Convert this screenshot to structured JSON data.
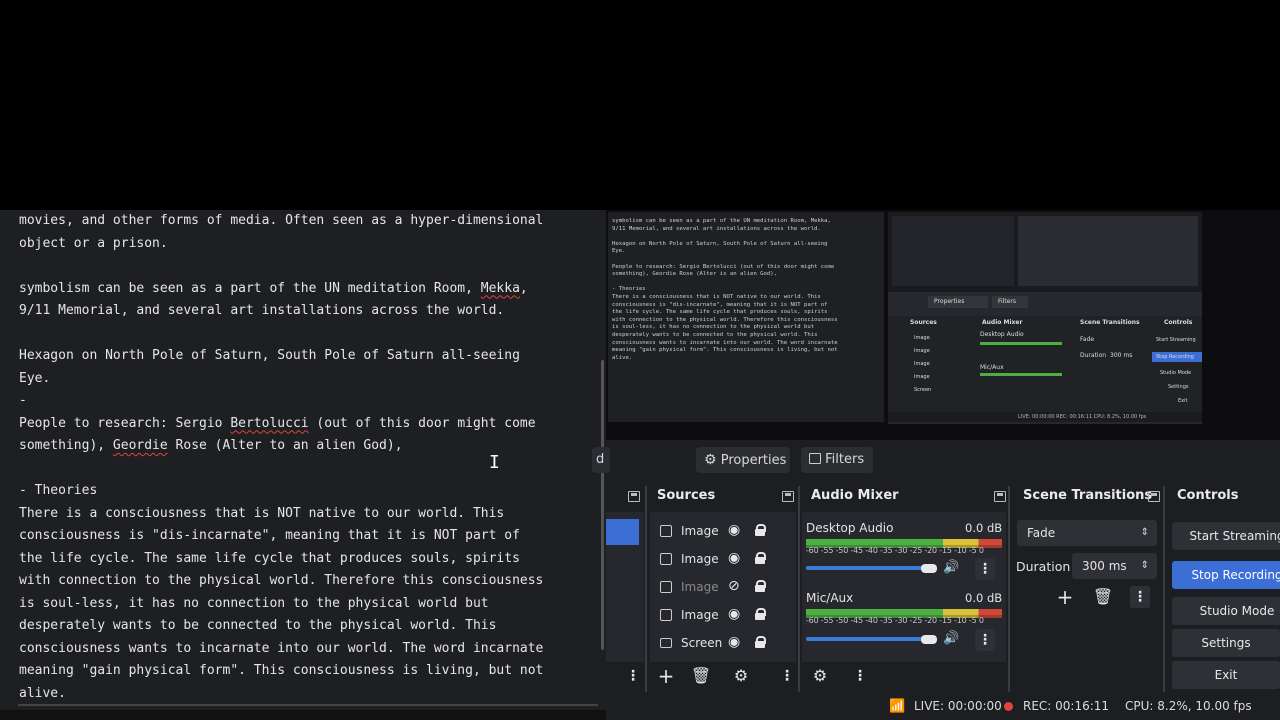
{
  "editor": {
    "lines": [
      {
        "segments": [
          {
            "text": "movies, and other forms of media. Often seen as a hyper-dimensional"
          }
        ]
      },
      {
        "segments": [
          {
            "text": "object or a prison."
          }
        ]
      },
      {
        "segments": [
          {
            "text": ""
          }
        ]
      },
      {
        "segments": [
          {
            "text": "symbolism can be seen as a part of the UN meditation Room, "
          },
          {
            "text": "Mekka",
            "spell": true
          },
          {
            "text": ","
          }
        ]
      },
      {
        "segments": [
          {
            "text": "9/11 Memorial, and several art installations across the world."
          }
        ]
      },
      {
        "segments": [
          {
            "text": ""
          }
        ]
      },
      {
        "segments": [
          {
            "text": "Hexagon on North Pole of Saturn, South Pole of Saturn all-seeing"
          }
        ]
      },
      {
        "segments": [
          {
            "text": "Eye."
          }
        ]
      },
      {
        "segments": [
          {
            "text": "-"
          }
        ]
      },
      {
        "segments": [
          {
            "text": "People to research: Sergio "
          },
          {
            "text": "Bertolucci",
            "spell": true
          },
          {
            "text": " (out of this door might come"
          }
        ]
      },
      {
        "segments": [
          {
            "text": "something), "
          },
          {
            "text": "Geordie",
            "spell": true
          },
          {
            "text": " Rose (Alter to an alien God),"
          }
        ]
      },
      {
        "segments": [
          {
            "text": ""
          }
        ]
      },
      {
        "segments": [
          {
            "text": "- Theories"
          }
        ]
      },
      {
        "segments": [
          {
            "text": "There is a consciousness that is NOT native to our world. This"
          }
        ]
      },
      {
        "segments": [
          {
            "text": "consciousness is \"dis-incarnate\", meaning that it is NOT part of"
          }
        ]
      },
      {
        "segments": [
          {
            "text": "the life cycle. The same life cycle that produces souls, spirits"
          }
        ]
      },
      {
        "segments": [
          {
            "text": "with connection to the physical world. Therefore this consciousness"
          }
        ]
      },
      {
        "segments": [
          {
            "text": "is soul-less, it has no connection to the physical world but"
          }
        ]
      },
      {
        "segments": [
          {
            "text": "desperately wants to be connected to the physical world. This"
          }
        ]
      },
      {
        "segments": [
          {
            "text": "consciousness wants to incarnate into our world. The word incarnate"
          }
        ]
      },
      {
        "segments": [
          {
            "text": "meaning \"gain physical form\". This consciousness is living, but not"
          }
        ]
      },
      {
        "segments": [
          {
            "text": "alive."
          }
        ]
      }
    ]
  },
  "thumbnail": {
    "lines": [
      "symbolism can be seen as a part of the UN meditation Room, Mekka,",
      "9/11 Memorial, and several art installations across the world.",
      "",
      "Hexagon on North Pole of Saturn, South Pole of Saturn all-seeing",
      "Eye.",
      "",
      "People to research: Sergio Bertolucci (out of this door might come",
      "something), Geordie Rose (Alter is an alien God),",
      "",
      "- Theories",
      "There is a consciousness that is NOT native to our world. This",
      "consciousness is \"dis-incarnate\", meaning that it is NOT part of",
      "the life cycle. The same life cycle that produces souls, spirits",
      "with connection to the physical world. Therefore this consciousness",
      "is soul-less, it has no connection to the physical world but",
      "desperately wants to be connected to the physical world. This",
      "consciousness wants to incarnate into our world. The word incarnate",
      "meaning \"gain physical form\". This consciousness is living, but not",
      "alive."
    ],
    "obs_labels": {
      "properties": "Properties",
      "filters": "Filters",
      "sources": "Sources",
      "audio_mixer": "Audio Mixer",
      "scene_transitions": "Scene Transitions",
      "controls": "Controls",
      "desktop_audio": "Desktop Audio",
      "mic_aux": "Mic/Aux",
      "fade": "Fade",
      "duration": "Duration",
      "duration_value": "300 ms",
      "start_streaming": "Start Streaming",
      "stop_recording": "Stop Recording",
      "studio_mode": "Studio Mode",
      "settings": "Settings",
      "exit": "Exit",
      "source_image": "Image",
      "source_screen": "Screen",
      "status": "LIVE: 00:00:00   REC: 00:16:11   CPU: 8.2%, 10.00 fps"
    }
  },
  "obs": {
    "tabs": {
      "partial_label": "d",
      "properties": "Properties",
      "filters": "Filters"
    },
    "docks": {
      "sources": "Sources",
      "audio_mixer": "Audio Mixer",
      "scene_transitions": "Scene Transitions",
      "controls": "Controls"
    },
    "sources": [
      {
        "label": "Image (",
        "visible": true
      },
      {
        "label": "Image (",
        "visible": true
      },
      {
        "label": "Image (",
        "visible": false
      },
      {
        "label": "Image (",
        "visible": true
      },
      {
        "label": "Screen",
        "visible": true
      }
    ],
    "mixer": {
      "channels": [
        {
          "name": "Desktop Audio",
          "db": "0.0 dB",
          "volume": 1.0
        },
        {
          "name": "Mic/Aux",
          "db": "0.0 dB",
          "volume": 1.0
        }
      ],
      "scale": "-60 -55 -50 -45 -40 -35 -30 -25 -20 -15 -10 -5 0"
    },
    "transitions": {
      "selected": "Fade",
      "duration_label": "Duration",
      "duration_value": "300 ms"
    },
    "controls": {
      "start_streaming": "Start Streaming",
      "stop_recording": "Stop Recording",
      "studio_mode": "Studio Mode",
      "settings": "Settings",
      "exit": "Exit"
    },
    "status": {
      "live": "LIVE: 00:00:00",
      "rec": "REC: 00:16:11",
      "cpu": "CPU: 8.2%, 10.00 fps"
    }
  },
  "colors": {
    "accent": "#3b6fd6",
    "rec": "#e0443a",
    "editor_bg": "#1e1f22",
    "panel_bg": "#26282d"
  },
  "icons": {
    "properties": "gear-icon",
    "filters": "filter-icon",
    "add": "plus-icon",
    "remove": "trash-icon",
    "source_settings": "gear-icon",
    "advanced_audio": "cog-icon",
    "menu": "kebab-icon"
  }
}
